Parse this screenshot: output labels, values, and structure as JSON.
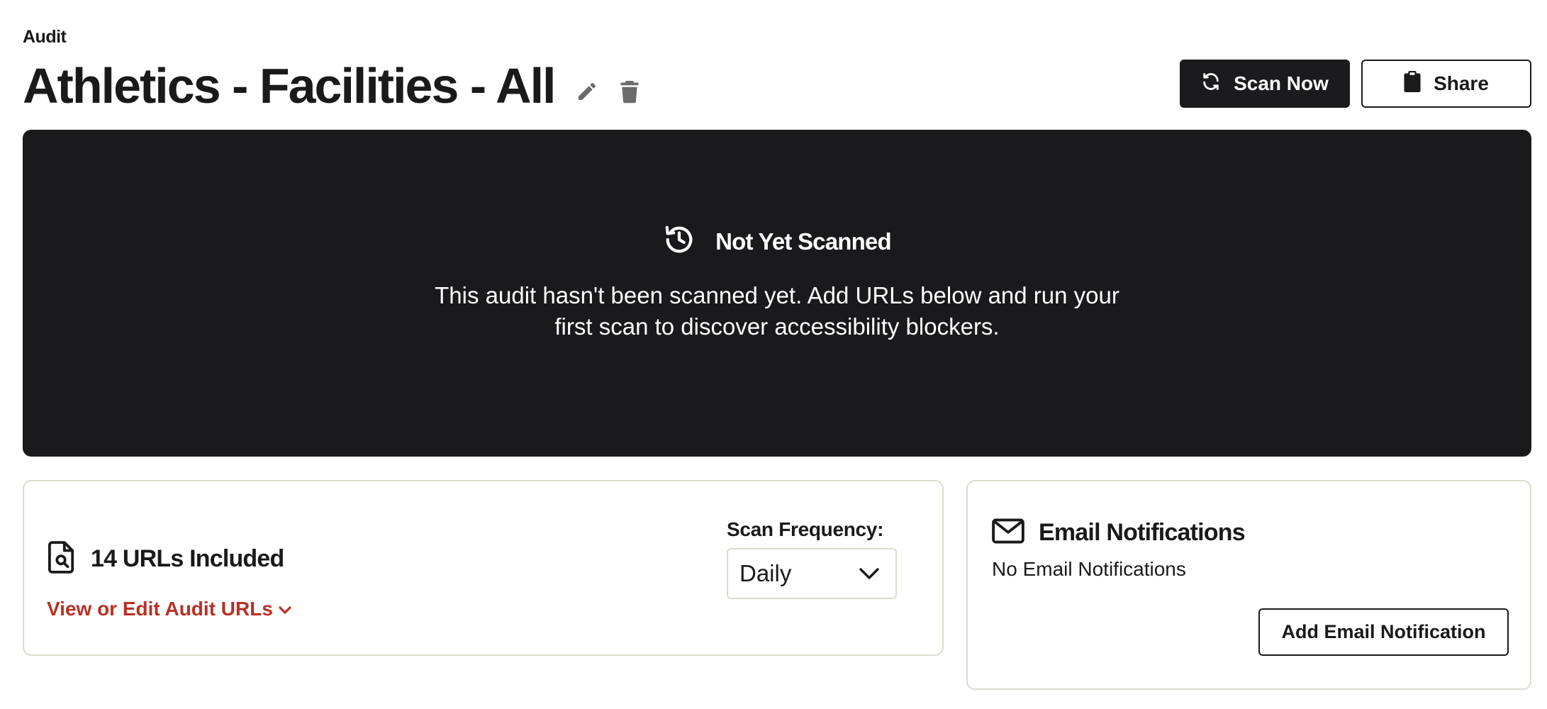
{
  "header": {
    "eyebrow": "Audit",
    "title": "Athletics - Facilities - All",
    "edit_icon": "pencil-icon",
    "delete_icon": "trash-icon"
  },
  "actions": {
    "scan_label": "Scan Now",
    "scan_icon": "refresh-icon",
    "share_label": "Share",
    "share_icon": "clipboard-icon"
  },
  "banner": {
    "icon": "history-icon",
    "title": "Not Yet Scanned",
    "message": "This audit hasn't been scanned yet. Add URLs below and run your first scan to discover accessibility blockers."
  },
  "urls_card": {
    "icon": "file-search-icon",
    "title": "14 URLs Included",
    "link_label": "View or Edit Audit URLs",
    "frequency_label": "Scan Frequency:",
    "frequency_value": "Daily"
  },
  "email_card": {
    "icon": "envelope-icon",
    "title": "Email Notifications",
    "empty_text": "No Email Notifications",
    "add_label": "Add Email Notification"
  },
  "colors": {
    "dark": "#1a1a1c",
    "accent_link": "#b73125",
    "card_border": "#dcdbd0",
    "icon_gray": "#6b6b6b"
  }
}
